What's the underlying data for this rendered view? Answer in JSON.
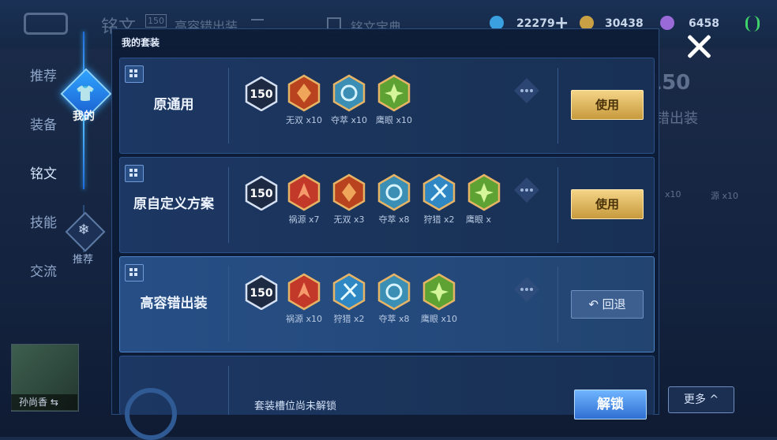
{
  "topbar": {
    "back_label": "",
    "page_title": "铭文",
    "badge_level": "150",
    "set_name": "高容错出装",
    "encyclopedia": "铭文宝典",
    "currency": [
      {
        "value": "22279",
        "color": "#3aa0e0"
      },
      {
        "value": "30438",
        "color": "#c9a043"
      },
      {
        "value": "6458",
        "color": "#9a6ad8"
      }
    ],
    "plus": "+"
  },
  "leftnav": {
    "items": [
      "推荐",
      "装备",
      "铭文",
      "技能",
      "交流"
    ],
    "mine_label": "我的",
    "recommend_label": "推荐"
  },
  "hero": {
    "name": "孙尚香"
  },
  "background": {
    "level": "150",
    "set_label": "错出装",
    "rune_labels": [
      "x10",
      "源 x10"
    ]
  },
  "panel": {
    "title": "我的套装",
    "cards": [
      {
        "name": "原通用",
        "level": "150",
        "button": "使用",
        "runes": [
          {
            "label": "无双 x10",
            "color": "#d95a2b",
            "accent": "#f0a65a"
          },
          {
            "label": "夺萃 x10",
            "color": "#4ab0d8",
            "accent": "#9fe3ff"
          },
          {
            "label": "鹰眼 x10",
            "color": "#6fbf3a",
            "accent": "#c8f08a"
          }
        ]
      },
      {
        "name": "原自定义方案",
        "level": "150",
        "button": "使用",
        "runes": [
          {
            "label": "祸源 x7",
            "color": "#d84a32",
            "accent": "#f59a6a"
          },
          {
            "label": "无双 x3",
            "color": "#d95a2b",
            "accent": "#f0a65a"
          },
          {
            "label": "夺萃 x8",
            "color": "#4ab0d8",
            "accent": "#9fe3ff"
          },
          {
            "label": "狩猎 x2",
            "color": "#3aa7e0",
            "accent": "#a8ecff"
          },
          {
            "label": "鹰眼 x",
            "color": "#6fbf3a",
            "accent": "#c8f08a"
          }
        ]
      },
      {
        "name": "高容错出装",
        "level": "150",
        "button": "回退",
        "runes": [
          {
            "label": "祸源 x10",
            "color": "#d84a32",
            "accent": "#f59a6a"
          },
          {
            "label": "狩猎 x2",
            "color": "#3aa7e0",
            "accent": "#a8ecff"
          },
          {
            "label": "夺萃 x8",
            "color": "#4ab0d8",
            "accent": "#9fe3ff"
          },
          {
            "label": "鹰眼 x10",
            "color": "#6fbf3a",
            "accent": "#c8f08a"
          }
        ]
      }
    ],
    "locked": {
      "text": "套装槽位尚未解锁",
      "button": "解锁"
    }
  },
  "more_button": "更多",
  "colors": {
    "gold": "#e8c46e",
    "accent": "#37a4ff",
    "panel": "#0e1c36"
  }
}
